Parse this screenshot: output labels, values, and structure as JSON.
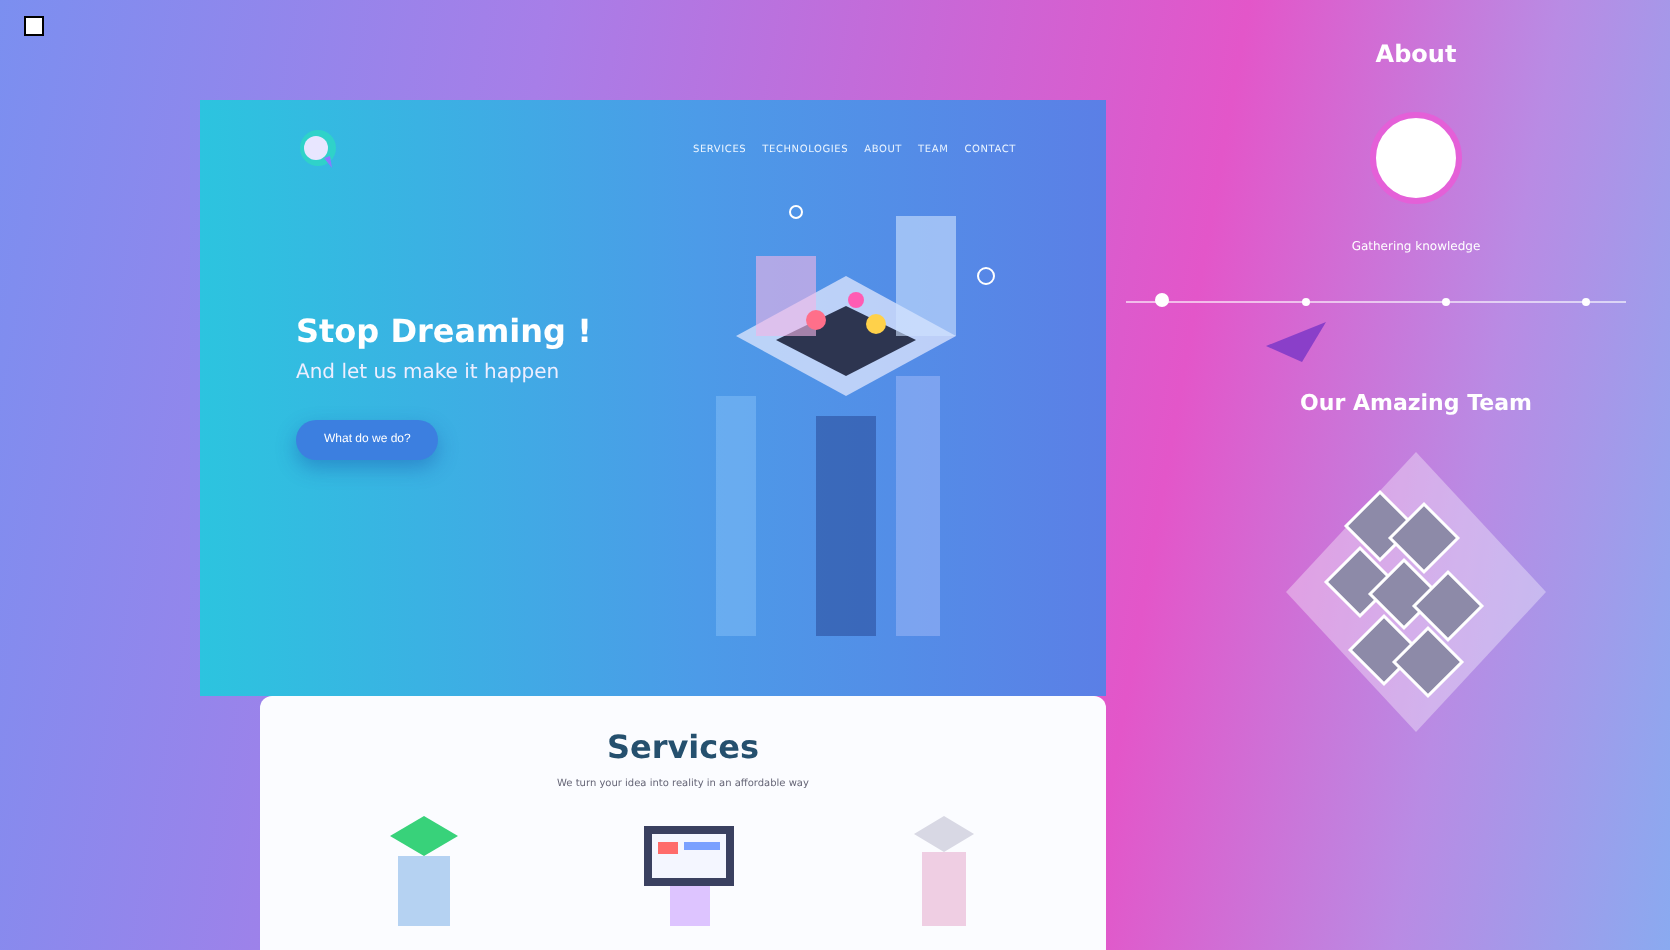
{
  "nav": {
    "items": [
      "SERVICES",
      "TECHNOLOGIES",
      "ABOUT",
      "TEAM",
      "CONTACT"
    ]
  },
  "hero": {
    "title": "Stop Dreaming !",
    "subtitle": "And let us make it happen",
    "button": "What do we do?"
  },
  "services": {
    "title": "Services",
    "subtitle": "We turn your idea into reality in an affordable way"
  },
  "about": {
    "title": "About",
    "step_title": "Gathering knowledge"
  },
  "team": {
    "title": "Our Amazing Team"
  }
}
